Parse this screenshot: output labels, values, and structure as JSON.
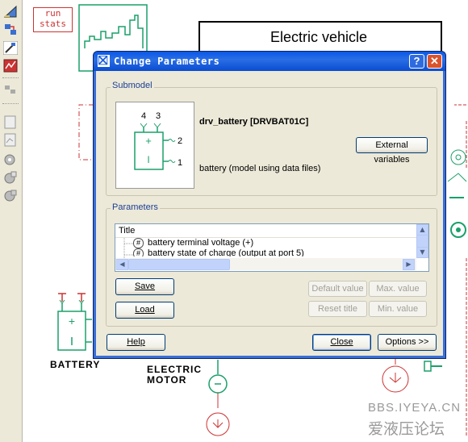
{
  "canvas": {
    "run_stats_label": "run\nstats",
    "vehicle_title": "Electric vehicle",
    "battery_label": "BATTERY",
    "motor_label_line1": "ELECTRIC",
    "motor_label_line2": "MOTOR",
    "watermark_line1": "BBS.IYEYA.CN",
    "watermark_line2": "爱液压论坛"
  },
  "dialog": {
    "title": "Change Parameters",
    "help_button": "?",
    "close_button": "✕",
    "submodel": {
      "group_label": "Submodel",
      "name": "drv_battery [DRVBAT01C]",
      "description": "battery (model using data files)",
      "external_variables_button": "External variables",
      "port_top_left": "4",
      "port_top_right": "3",
      "port_right_top": "2",
      "port_right_bottom": "1",
      "plus_sign": "+",
      "minus_sign": "I"
    },
    "parameters": {
      "group_label": "Parameters",
      "column_title": "Title",
      "rows": [
        "battery terminal voltage (+)",
        "battery state of charge (output at port 5)"
      ],
      "row_icon": "#"
    },
    "buttons": {
      "save": "Save",
      "load": "Load",
      "default_value": "Default value",
      "max_value": "Max. value",
      "reset_title": "Reset title",
      "min_value": "Min. value",
      "help": "Help",
      "close": "Close",
      "options": "Options >>"
    }
  },
  "colors": {
    "titlebar": "#0a58e8",
    "dialog_face": "#ece9d8",
    "diagram_red": "#cc3333",
    "diagram_green": "#1aa06a",
    "group_label": "#1c3f94"
  }
}
